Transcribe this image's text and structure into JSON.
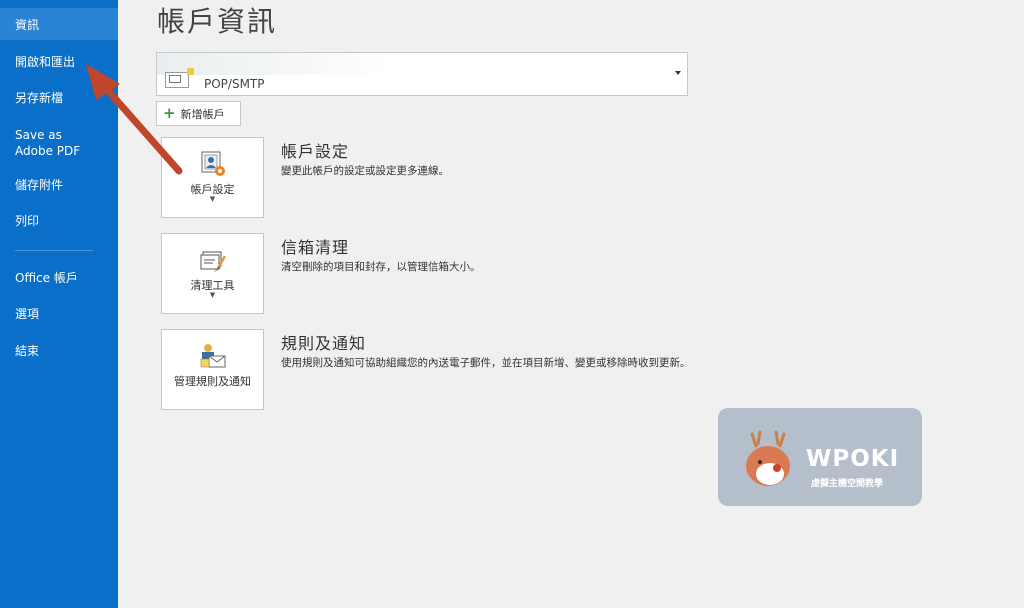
{
  "sidebar": {
    "items": [
      {
        "label": "資訊"
      },
      {
        "label": "開啟和匯出"
      },
      {
        "label": "另存新檔"
      },
      {
        "label": "Save as Adobe PDF"
      },
      {
        "label": "儲存附件"
      },
      {
        "label": "列印"
      },
      {
        "label": "Office 帳戶"
      },
      {
        "label": "選項"
      },
      {
        "label": "結束"
      }
    ]
  },
  "main": {
    "title": "帳戶資訊",
    "account_type": "POP/SMTP",
    "add_account_label": "新增帳戶",
    "sections": [
      {
        "tile_label": "帳戶設定",
        "title": "帳戶設定",
        "description": "變更此帳戶的設定或設定更多連線。"
      },
      {
        "tile_label": "清理工具",
        "title": "信箱清理",
        "description": "清空刪除的項目和封存，以管理信箱大小。"
      },
      {
        "tile_label": "管理規則及通知",
        "title": "規則及通知",
        "description": "使用規則及通知可協助組織您的內送電子郵件，並在項目新增、變更或移除時收到更新。"
      }
    ]
  },
  "watermark": {
    "brand": "WPOKI",
    "subtitle": "虛擬主機空間教學"
  },
  "colors": {
    "sidebar": "#0a6fc9",
    "sidebar_active": "#2a84d6",
    "annotation_arrow": "#c0452b"
  }
}
